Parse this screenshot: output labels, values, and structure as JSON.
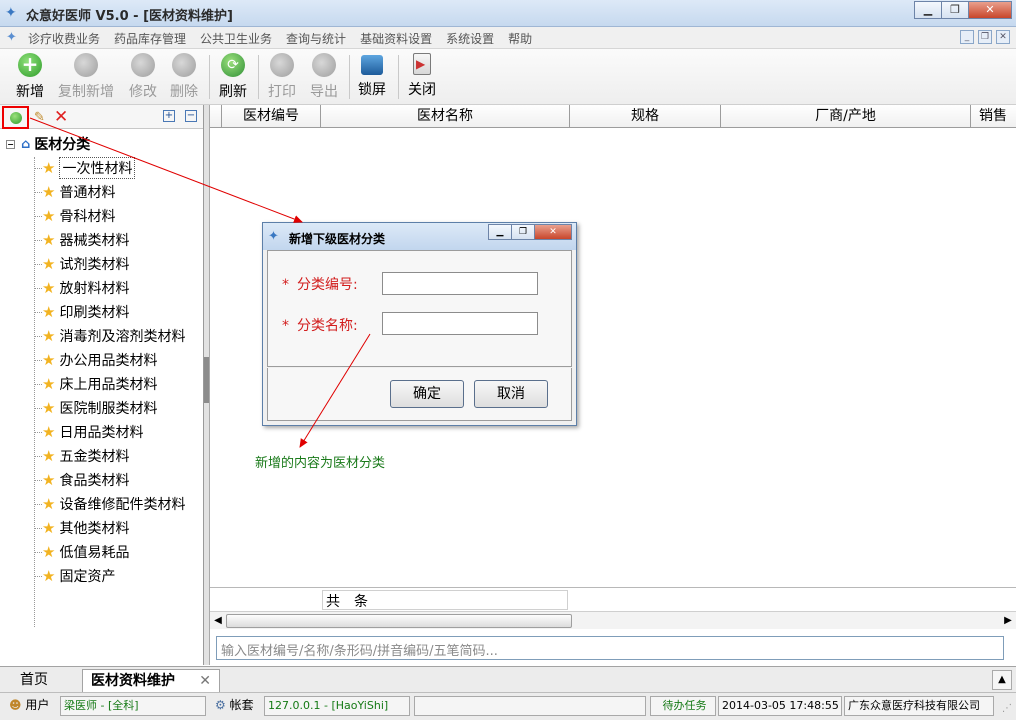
{
  "window": {
    "title": "众意好医师 V5.0 - [医材资料维护]",
    "buttons": [
      "minimize-icon",
      "restore-icon",
      "close-icon"
    ]
  },
  "menu": {
    "items": [
      "诊疗收费业务",
      "药品库存管理",
      "公共卫生业务",
      "查询与统计",
      "基础资料设置",
      "系统设置",
      "帮助"
    ]
  },
  "toolbar": {
    "new": "新增",
    "copy_new": "复制新增",
    "edit": "修改",
    "delete": "删除",
    "refresh": "刷新",
    "print": "打印",
    "export": "导出",
    "lock": "锁屏",
    "close": "关闭"
  },
  "tree": {
    "root": "医材分类",
    "items": [
      "一次性材料",
      "普通材料",
      "骨科材料",
      "器械类材料",
      "试剂类材料",
      "放射料材料",
      "印刷类材料",
      "消毒剂及溶剂类材料",
      "办公用品类材料",
      "床上用品类材料",
      "医院制服类材料",
      "日用品类材料",
      "五金类材料",
      "食品类材料",
      "设备维修配件类材料",
      "其他类材料",
      "低值易耗品",
      "固定资产"
    ],
    "selected_index": 0
  },
  "grid": {
    "columns": [
      "医材编号",
      "医材名称",
      "规格",
      "厂商/产地",
      "销售"
    ],
    "rows": [],
    "footer": "共　条"
  },
  "search": {
    "placeholder": "输入医材编号/名称/条形码/拼音编码/五笔简码..."
  },
  "dialog": {
    "title": "新增下级医材分类",
    "field1_label": "分类编号:",
    "field2_label": "分类名称:",
    "required_mark": "*",
    "ok": "确定",
    "cancel": "取消",
    "field1_value": "",
    "field2_value": ""
  },
  "annotation": "新增的内容为医材分类",
  "tabs": {
    "home": "首页",
    "active": "医材资料维护"
  },
  "status": {
    "user_label": "用户",
    "user_value": "梁医师 - [全科]",
    "account_label": "帐套",
    "account_value": "127.0.0.1 - [HaoYiShi]",
    "pending": "待办任务",
    "datetime": "2014-03-05 17:48:55",
    "company": "广东众意医疗科技有限公司"
  },
  "colors": {
    "accent_red": "#e00000",
    "annotation_green": "#1a7a1a",
    "required_red": "#d21d1d"
  }
}
